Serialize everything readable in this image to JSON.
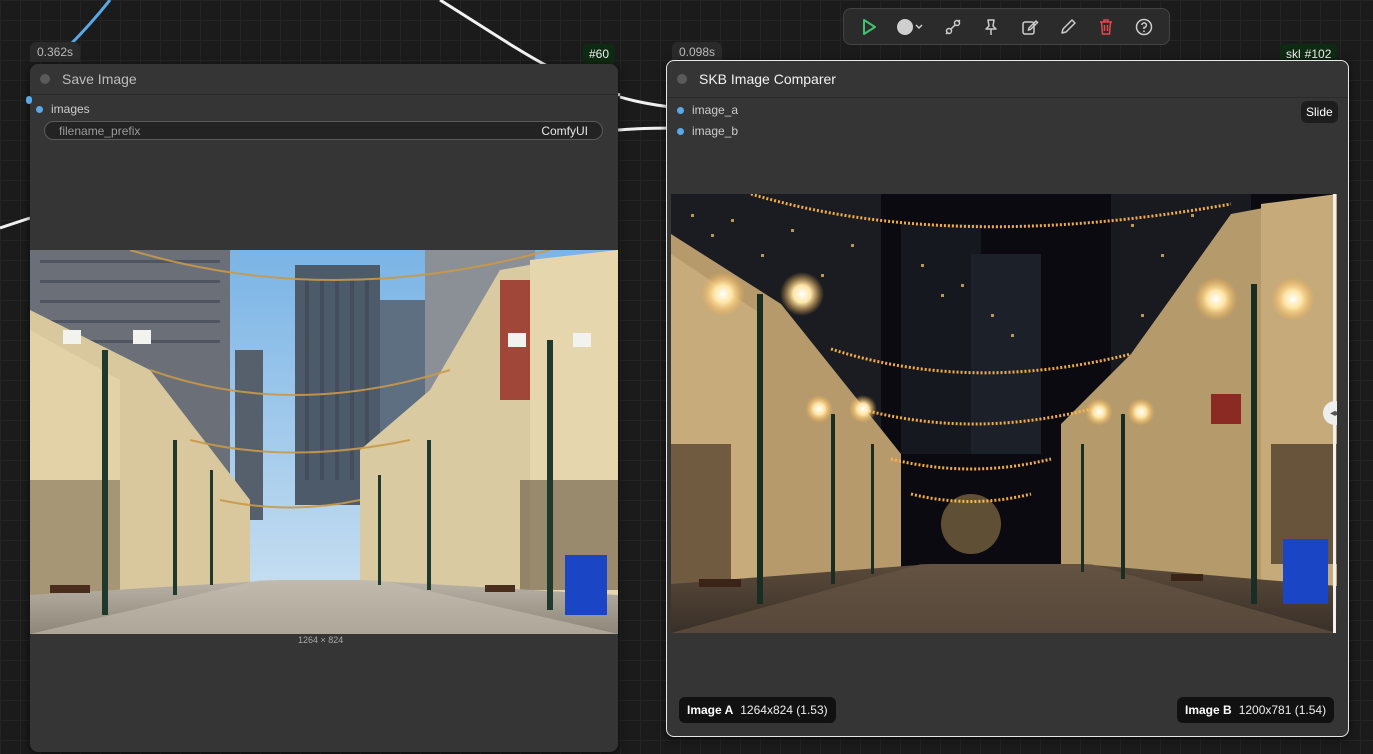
{
  "toolbar": {
    "icons": [
      "play-icon",
      "circle-dropdown-icon",
      "bypass-icon",
      "pin-icon",
      "edit-icon",
      "pencil-icon",
      "trash-icon",
      "help-icon"
    ]
  },
  "save_node": {
    "time": "0.362s",
    "id": "#60",
    "title": "Save Image",
    "input_label": "images",
    "widget_label": "filename_prefix",
    "widget_value": "ComfyUI",
    "image_dims": "1264 × 824"
  },
  "comparer_node": {
    "time": "0.098s",
    "tag": "skl",
    "id": "#102",
    "title": "SKB Image Comparer",
    "input_a": "image_a",
    "input_b": "image_b",
    "slide_label": "Slide",
    "label_a_name": "Image A",
    "label_a_info": "1264x824 (1.53)",
    "label_b_name": "Image B",
    "label_b_info": "1200x781 (1.54)"
  },
  "colors": {
    "slot_blue": "#5aa9e6",
    "play_green": "#3ec46d",
    "trash_red": "#e5484d",
    "id_badge_bg": "#0f2a12"
  }
}
